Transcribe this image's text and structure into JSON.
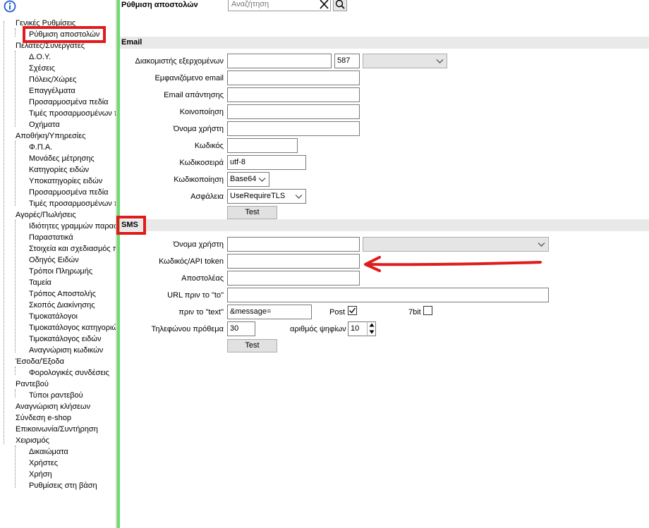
{
  "tree": {
    "items": [
      {
        "label": "Γενικές Ρυθμίσεις"
      },
      {
        "label": "Ρύθμιση αποστολών"
      },
      {
        "label": "Πελάτες/Συνεργάτες"
      },
      {
        "label": "Δ.Ο.Υ."
      },
      {
        "label": "Σχέσεις"
      },
      {
        "label": "Πόλεις/Χώρες"
      },
      {
        "label": "Επαγγέλματα"
      },
      {
        "label": "Προσαρμοσμένα πεδία"
      },
      {
        "label": "Τιμές προσαρμοσμένων π"
      },
      {
        "label": "Οχήματα"
      },
      {
        "label": "Αποθήκη/Υπηρεσίες"
      },
      {
        "label": "Φ.Π.Α."
      },
      {
        "label": "Μονάδες μέτρησης"
      },
      {
        "label": "Κατηγορίες ειδών"
      },
      {
        "label": "Υποκατηγορίες ειδών"
      },
      {
        "label": "Προσαρμοσμένα πεδία"
      },
      {
        "label": "Τιμές προσαρμοσμένων π"
      },
      {
        "label": "Αγορές/Πωλήσεις"
      },
      {
        "label": "Ιδιότητες γραμμών παραστ"
      },
      {
        "label": "Παραστατικά"
      },
      {
        "label": "Στοιχεία και σχεδιασμός π"
      },
      {
        "label": "Οδηγός Ειδών"
      },
      {
        "label": "Τρόποι Πληρωμής"
      },
      {
        "label": "Ταμεία"
      },
      {
        "label": "Τρόπος Αποστολής"
      },
      {
        "label": "Σκοπός Διακίνησης"
      },
      {
        "label": "Τιμοκατάλογοι"
      },
      {
        "label": "Τιμοκατάλογος κατηγοριώ"
      },
      {
        "label": "Τιμοκατάλογος ειδών"
      },
      {
        "label": "Αναγνώριση κωδικών"
      },
      {
        "label": "Έσοδα/Έξοδα"
      },
      {
        "label": "Φορολογικές συνδέσεις"
      },
      {
        "label": "Ραντεβού"
      },
      {
        "label": "Τύποι ραντεβού"
      },
      {
        "label": "Αναγνώριση κλήσεων"
      },
      {
        "label": "Σύνδεση e-shop"
      },
      {
        "label": "Επικοινωνία/Συντήρηση"
      },
      {
        "label": "Χειρισμός"
      },
      {
        "label": "Δικαιώματα"
      },
      {
        "label": "Χρήστες"
      },
      {
        "label": "Χρήση"
      },
      {
        "label": "Ρυθμίσεις στη βάση"
      }
    ]
  },
  "header": {
    "title": "Ρύθμιση αποστολών",
    "search_placeholder": "Αναζήτηση"
  },
  "email": {
    "section_title": "Email",
    "server_label": "Διακομιστής εξερχομένων",
    "server_value": "",
    "port_value": "587",
    "display_email_label": "Εμφανιζόμενο email",
    "reply_email_label": "Email απάντησης",
    "cc_label": "Κοινοποίηση",
    "username_label": "Όνομα χρήστη",
    "password_label": "Κωδικός",
    "charset_label": "Κωδικοσειρά",
    "charset_value": "utf-8",
    "encoding_label": "Κωδικοποίηση",
    "encoding_value": "Base64",
    "security_label": "Ασφάλεια",
    "security_value": "UseRequireTLS",
    "test_label": "Test"
  },
  "sms": {
    "section_title": "SMS",
    "username_label": "Όνομα χρήστη",
    "token_label": "Κωδικός/API token",
    "sender_label": "Αποστολέας",
    "url_label": "URL πριν το \"to\"",
    "before_text_label": "πριν το \"text\"",
    "before_text_value": "&message=",
    "post_label": "Post",
    "post_checked": true,
    "sevenbit_label": "7bit",
    "sevenbit_checked": false,
    "prefix_label": "Τηλεφώνου πρόθεμα",
    "prefix_value": "30",
    "digits_label": "αριθμός ψηφίων",
    "digits_value": "10",
    "test_label": "Test"
  },
  "colors": {
    "accent_green": "#66e066",
    "annotation_red": "#e01b1b"
  }
}
